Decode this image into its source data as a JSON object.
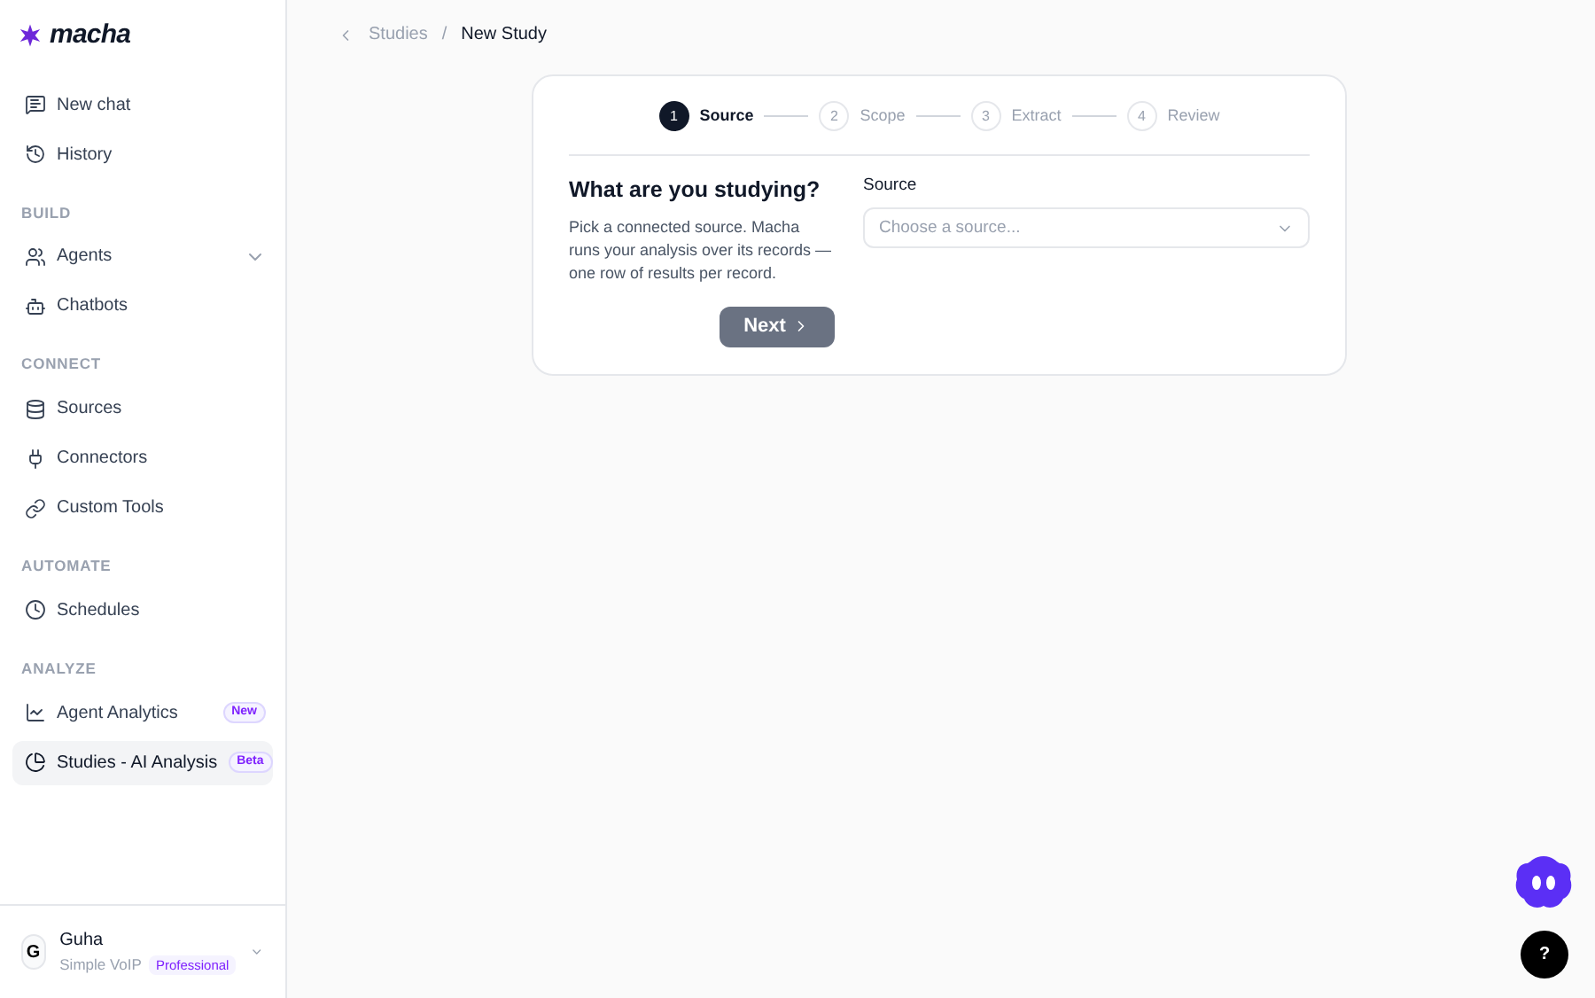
{
  "brand": {
    "name": "macha"
  },
  "nav": [
    {
      "kind": "item",
      "label": "New chat",
      "selected": false
    },
    {
      "kind": "item",
      "label": "History",
      "selected": false
    },
    {
      "kind": "heading",
      "label": "BUILD"
    },
    {
      "kind": "item",
      "label": "Agents",
      "selected": false,
      "expanded": false
    },
    {
      "kind": "item",
      "label": "Chatbots",
      "selected": false
    },
    {
      "kind": "heading",
      "label": "CONNECT"
    },
    {
      "kind": "item",
      "label": "Sources",
      "selected": false
    },
    {
      "kind": "item",
      "label": "Connectors",
      "selected": false
    },
    {
      "kind": "item",
      "label": "Custom Tools",
      "selected": false
    },
    {
      "kind": "heading",
      "label": "AUTOMATE"
    },
    {
      "kind": "item",
      "label": "Schedules",
      "selected": false
    },
    {
      "kind": "heading",
      "label": "ANALYZE"
    },
    {
      "kind": "item",
      "label": "Agent Analytics",
      "selected": false,
      "badge": "New"
    },
    {
      "kind": "item",
      "label": "Studies - AI Analysis",
      "selected": true,
      "badge": "Beta"
    }
  ],
  "user": {
    "initial": "G",
    "name": "Guha",
    "org": "Simple VoIP",
    "plan": "Professional"
  },
  "breadcrumb": [
    "Studies",
    "New Study"
  ],
  "breadcrumb_separator": "/",
  "steps": [
    {
      "number": "1",
      "label": "Source",
      "selected": true
    },
    {
      "number": "2",
      "label": "Scope",
      "selected": false
    },
    {
      "number": "3",
      "label": "Extract",
      "selected": false
    },
    {
      "number": "4",
      "label": "Review",
      "selected": false
    }
  ],
  "form": {
    "title": "What are you studying?",
    "description": "Pick a connected source. Macha runs your analysis over its records — one row of results per record.",
    "field_label": "Source",
    "placeholder": "Choose a source...",
    "next": "Next",
    "next_disabled": true
  },
  "help": "?"
}
